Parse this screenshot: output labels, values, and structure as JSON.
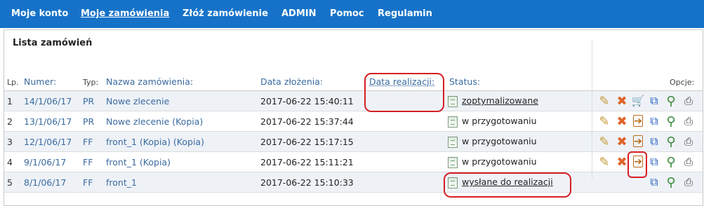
{
  "nav": {
    "items": [
      {
        "label": "Moje konto"
      },
      {
        "label": "Moje zamówienia"
      },
      {
        "label": "Złóż zamówienie"
      },
      {
        "label": "ADMIN"
      },
      {
        "label": "Pomoc"
      },
      {
        "label": "Regulamin"
      }
    ]
  },
  "panel": {
    "title": "Lista zamówień"
  },
  "headers": {
    "lp": "Lp.",
    "numer": "Numer:",
    "typ": "Typ:",
    "nazwa": "Nazwa zamówienia:",
    "data_zlozenia": "Data złożenia:",
    "data_realizacji": "Data realizacji:",
    "status": "Status:",
    "opcje": "Opcje:"
  },
  "rows": [
    {
      "lp": "1",
      "numer": "14/1/06/17",
      "typ": "PR",
      "nazwa": "Nowe zlecenie",
      "data": "2017-06-22 15:40:11",
      "status": "zoptymalizowane"
    },
    {
      "lp": "2",
      "numer": "13/1/06/17",
      "typ": "PR",
      "nazwa": "Nowe zlecenie (Kopia)",
      "data": "2017-06-22 15:37:44",
      "status": "w przygotowaniu"
    },
    {
      "lp": "3",
      "numer": "12/1/06/17",
      "typ": "FF",
      "nazwa": "front_1 (Kopia) (Kopia)",
      "data": "2017-06-22 15:17:15",
      "status": "w przygotowaniu"
    },
    {
      "lp": "4",
      "numer": "9/1/06/17",
      "typ": "FF",
      "nazwa": "front_1 (Kopia)",
      "data": "2017-06-22 15:11:21",
      "status": "w przygotowaniu"
    },
    {
      "lp": "5",
      "numer": "8/1/06/17",
      "typ": "FF",
      "nazwa": "front_1",
      "data": "2017-06-22 15:10:33",
      "status": "wysłane do realizacji"
    }
  ],
  "icons": {
    "edit": "✎",
    "delete": "✖",
    "cart": "🛒",
    "copy": "⧉",
    "search": "⚲",
    "print": "⎙",
    "send": "➔"
  },
  "colors": {
    "nav_bg": "#1672c8",
    "highlight": "#d61f26",
    "link": "#3a6aa0"
  }
}
